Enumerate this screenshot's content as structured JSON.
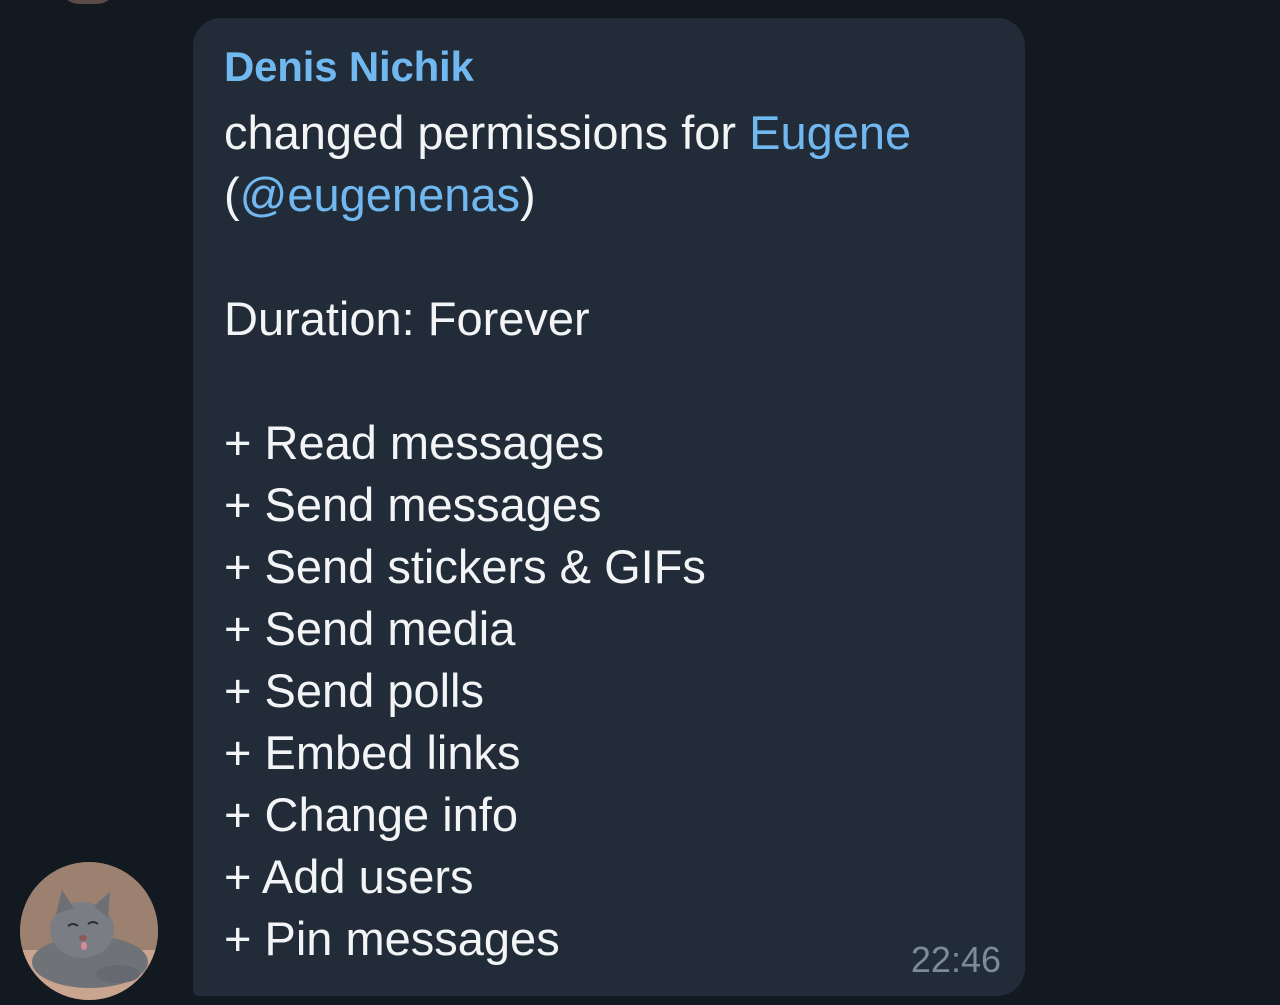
{
  "message": {
    "sender": "Denis Nichik",
    "action_prefix": "changed permissions for ",
    "target_name": "Eugene",
    "target_open": "(",
    "target_username": "@eugenenas",
    "target_close": ")",
    "duration": "Duration: Forever",
    "permissions": [
      "+ Read messages",
      "+ Send messages",
      "+ Send stickers & GIFs",
      "+ Send media",
      "+ Send polls",
      "+ Embed links",
      "+ Change info",
      "+ Add users",
      "+ Pin messages"
    ],
    "time": "22:46"
  },
  "avatar": {
    "icon": "cat-photo-avatar"
  },
  "colors": {
    "background": "#131920",
    "bubble": "#222c38",
    "accent_link": "#71b8f0",
    "text": "#f2f4f6",
    "time": "#7e8a98"
  }
}
